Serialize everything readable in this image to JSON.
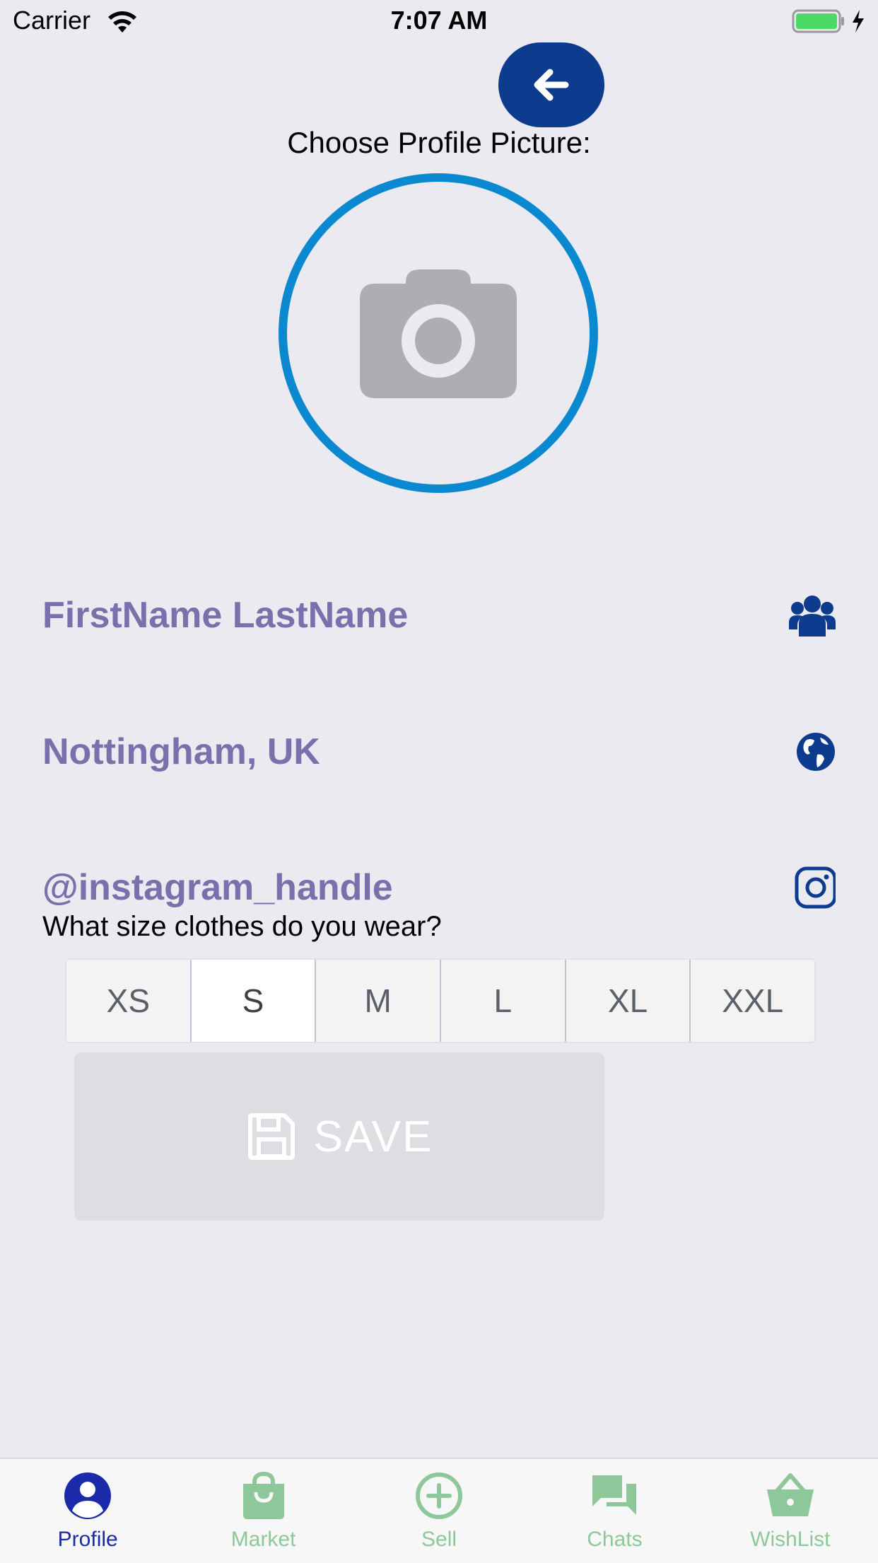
{
  "status_bar": {
    "carrier": "Carrier",
    "time": "7:07 AM"
  },
  "header": {
    "back_icon": "arrow-left-icon",
    "choose_label": "Choose Profile Picture:"
  },
  "profile": {
    "photo_icon": "camera-icon",
    "name": "FirstName LastName",
    "name_icon": "users-icon",
    "location": "Nottingham, UK",
    "location_icon": "globe-icon",
    "instagram": "@instagram_handle",
    "instagram_icon": "instagram-icon"
  },
  "size": {
    "question": "What size clothes do you wear?",
    "options": [
      "XS",
      "S",
      "M",
      "L",
      "XL",
      "XXL"
    ],
    "selected": "S"
  },
  "save": {
    "label": "SAVE",
    "icon": "floppy-disk-icon"
  },
  "tabs": [
    {
      "label": "Profile",
      "icon": "user-circle-icon",
      "active": true
    },
    {
      "label": "Market",
      "icon": "shopping-bag-icon",
      "active": false
    },
    {
      "label": "Sell",
      "icon": "plus-circle-icon",
      "active": false
    },
    {
      "label": "Chats",
      "icon": "chat-bubbles-icon",
      "active": false
    },
    {
      "label": "WishList",
      "icon": "basket-icon",
      "active": false
    }
  ],
  "colors": {
    "accent_blue": "#0d3b8e",
    "ring_blue": "#0a89d0",
    "info_text": "#7b70ab",
    "tab_inactive": "#8ec89a",
    "tab_active": "#1a2aa8"
  }
}
